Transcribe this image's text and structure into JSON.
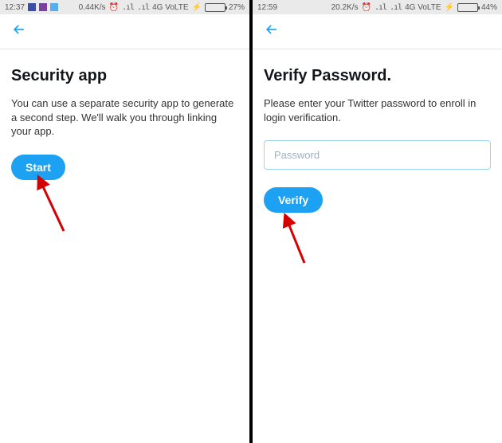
{
  "left": {
    "status": {
      "time": "12:37",
      "net": "0.44K/s",
      "carrier": "4G VoLTE",
      "battery_pct": "27%",
      "battery_fill": "27%"
    },
    "title": "Security app",
    "desc": "You can use a separate security app to generate a second step. We'll walk you through linking your app.",
    "button": "Start"
  },
  "right": {
    "status": {
      "time": "12:59",
      "net": "20.2K/s",
      "carrier": "4G VoLTE",
      "battery_pct": "44%",
      "battery_fill": "44%"
    },
    "title": "Verify Password.",
    "desc": "Please enter your Twitter password to enroll in login verification.",
    "placeholder": "Password",
    "button": "Verify"
  },
  "icons": {
    "alarm": "⏰",
    "signal": ".ıl"
  }
}
